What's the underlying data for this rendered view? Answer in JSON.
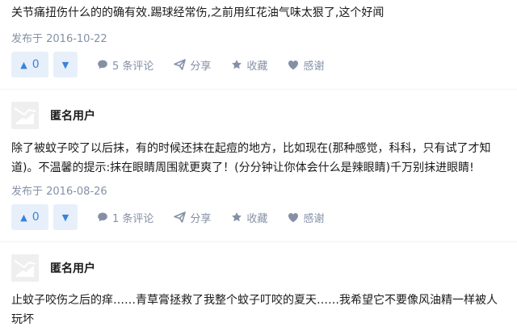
{
  "answers": [
    {
      "text": "关节痛扭伤什么的的确有效.踢球经常伤,之前用红花油气味太狠了,这个好闻",
      "published": "发布于 2016-10-22",
      "upvotes": "0",
      "comments": "5 条评论",
      "share": "分享",
      "favorite": "收藏",
      "thanks": "感谢"
    },
    {
      "author": "匿名用户",
      "text": "除了被蚊子咬了以后抹，有的时候还抹在起痘的地方，比如现在(那种感觉，科科，只有试了才知道)。不温馨的提示:抹在眼睛周围就更爽了！(分分钟让你体会什么是辣眼睛)千万别抹进眼睛!",
      "published": "发布于 2016-08-26",
      "upvotes": "0",
      "comments": "1 条评论",
      "share": "分享",
      "favorite": "收藏",
      "thanks": "感谢"
    },
    {
      "author": "匿名用户",
      "text": "止蚊子咬伤之后的痒……青草膏拯救了我整个蚊子叮咬的夏天……我希望它不要像风油精一样被人玩坏"
    }
  ],
  "colors": {
    "accent": "#3b82d8",
    "vote_bg": "#e7f0fa",
    "meta": "#8590a6"
  },
  "icons": {
    "comment": "comment-bubble-icon",
    "share": "paper-plane-icon",
    "favorite": "star-icon",
    "thanks": "heart-icon",
    "upvote": "triangle-up-icon",
    "downvote": "triangle-down-icon",
    "avatar": "anonymous-avatar-icon"
  }
}
